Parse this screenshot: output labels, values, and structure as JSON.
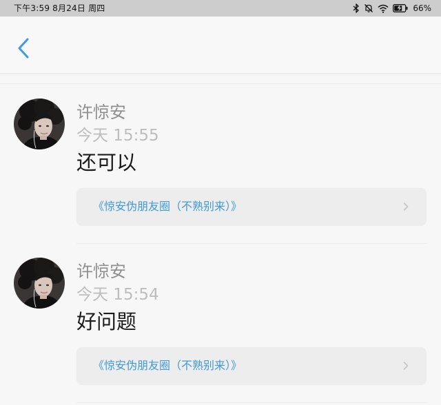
{
  "status_bar": {
    "time_date": "下午3:59  8月24日 周四",
    "battery_percent": "66%",
    "icons": [
      "bluetooth-icon",
      "mute-bell-icon",
      "wifi-icon",
      "battery-charging-icon"
    ]
  },
  "header": {
    "back_icon": "chevron-left-icon",
    "accent_color": "#3b9be6"
  },
  "comments": [
    {
      "author": "许惊安",
      "time": "今天 15:55",
      "text": "还可以",
      "link": "《惊安伪朋友圈（不熟别来）》"
    },
    {
      "author": "许惊安",
      "time": "今天 15:54",
      "text": "好问题",
      "link": "《惊安伪朋友圈（不熟别来）》"
    }
  ],
  "colors": {
    "background": "#f7f7f7",
    "link": "#3f9ad6",
    "card": "#ededed",
    "author": "#8f8f8f",
    "time": "#bdbdbd"
  }
}
